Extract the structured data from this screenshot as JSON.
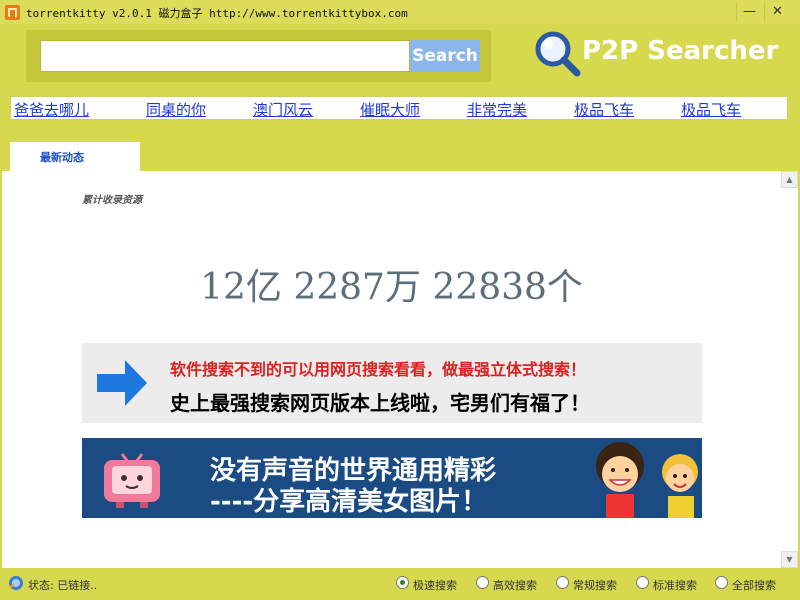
{
  "window": {
    "title": "torrentkitty v2.0.1 磁力盒子 http://www.torrentkittybox.com",
    "minimize": "—",
    "close": "✕"
  },
  "search": {
    "value": "",
    "placeholder": "",
    "button_label": "Search"
  },
  "logo": {
    "text": "P2P Searcher",
    "icon": "magnifier-icon"
  },
  "hot_keywords": [
    "爸爸去哪儿",
    "同桌的你",
    "澳门风云",
    "催眠大师",
    "非常完美",
    "极品飞车",
    "极品飞车"
  ],
  "tabs": [
    {
      "label": "最新动态",
      "active": true
    }
  ],
  "content": {
    "section_label": "累计收录资源",
    "count": "12亿 2287万 22838个"
  },
  "banner1": {
    "line1": "软件搜索不到的可以用网页搜索看看，做最强立体式搜索！",
    "line2": "史上最强搜索网页版本上线啦，宅男们有福了！",
    "icon": "arrow-right-icon"
  },
  "banner2": {
    "line1": "没有声音的世界通用精彩",
    "line2": "----分享高清美女图片！",
    "icon": "tv-mascot-icon"
  },
  "status": {
    "text": "状态: 已链接.."
  },
  "search_modes": [
    {
      "label": "极速搜索",
      "checked": true
    },
    {
      "label": "高效搜索",
      "checked": false
    },
    {
      "label": "常规搜索",
      "checked": false
    },
    {
      "label": "标准搜索",
      "checked": false
    },
    {
      "label": "全部搜索",
      "checked": false
    }
  ],
  "colors": {
    "chrome": "#d6d94e",
    "search_button": "#8ab6ec",
    "link": "#2038d8",
    "banner_red": "#e02020",
    "banner2_bg": "#1a4b82"
  }
}
